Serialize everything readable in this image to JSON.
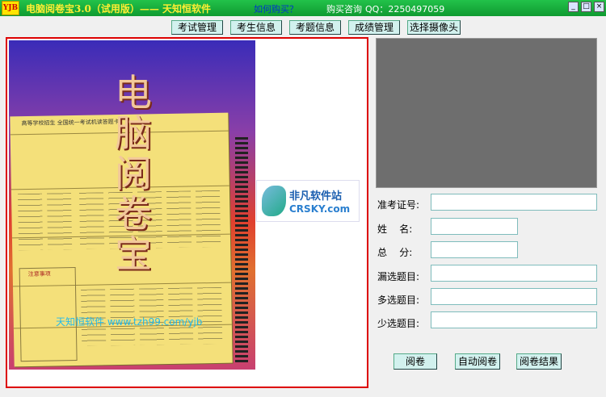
{
  "titlebar": {
    "logo_text": "YJB",
    "app_title": "电脑阅卷宝3.0（试用版）—— 天知恒软件",
    "buy_link": "如何购买？",
    "consult_label": "购买咨询",
    "qq": "QQ：2250497059",
    "window_buttons": [
      "_",
      "□",
      "×"
    ]
  },
  "toolbar": {
    "buttons": [
      "考试管理",
      "考生信息",
      "考题信息",
      "成绩管理",
      "选择摄像头"
    ]
  },
  "image_panel": {
    "title": "电脑阅卷宝",
    "card_header": "高等学校招生  全国统一考试机读答题卡",
    "notice_title": "注意事项",
    "watermark": "天知恒软件 www.tzh99.com/yjb",
    "badge_cn": "非凡软件站",
    "badge_en": "CRSKY.com"
  },
  "form": {
    "exam_id_label": "准考证号:",
    "name_label": "姓    名:",
    "total_label": "总    分:",
    "missed_label": "漏选题目:",
    "extra_label": "多选题目:",
    "less_label": "少选题目:",
    "exam_id_value": "",
    "name_value": "",
    "total_value": "",
    "missed_value": "",
    "extra_value": "",
    "less_value": ""
  },
  "actions": {
    "grade": "阅卷",
    "auto_grade": "自动阅卷",
    "result": "阅卷结果"
  }
}
